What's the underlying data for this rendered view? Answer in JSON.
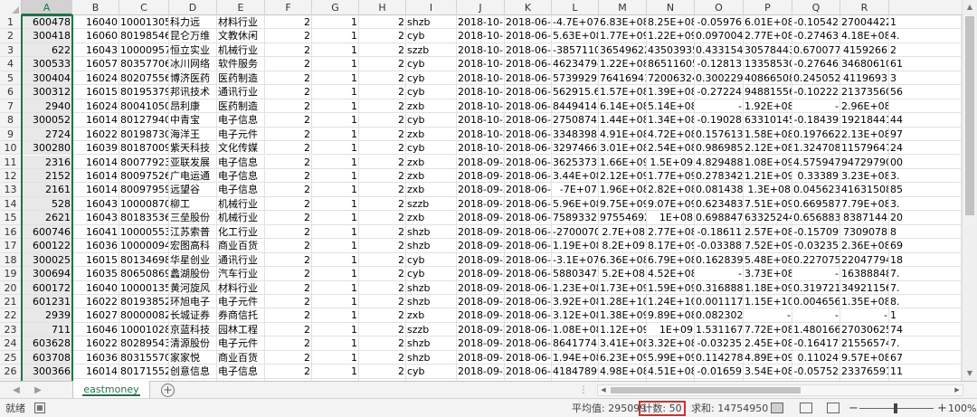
{
  "columns": [
    "A",
    "B",
    "C",
    "D",
    "E",
    "F",
    "G",
    "H",
    "I",
    "J",
    "K",
    "L",
    "M",
    "N",
    "O",
    "P",
    "Q",
    "R"
  ],
  "selected_column": "A",
  "rows": [
    [
      "600478",
      "16040",
      "10001305",
      "科力远",
      "材料行业",
      "2",
      "1",
      "2",
      "shzb",
      "2018-10-1",
      "2018-06-3",
      "-4.7E+07",
      "6.83E+08",
      "8.25E+08",
      "-0.05976",
      "6.01E+08",
      "-0.10542",
      "27004422"
    ],
    [
      "300418",
      "16060",
      "80198546",
      "昆仑万维",
      "文教休闲",
      "2",
      "1",
      "2",
      "cyb",
      "2018-10-1",
      "2018-06-3",
      "5.63E+08",
      "1.77E+09",
      "1.22E+09",
      "0.097004",
      "2.77E+08",
      "-0.27463",
      "4.18E+08"
    ],
    [
      "622",
      "16043",
      "10000957",
      "恒立实业",
      "机械行业",
      "2",
      "1",
      "2",
      "szzb",
      "2018-10-1",
      "2018-06-3",
      "-3857110",
      "36549622",
      "43503935",
      "0.433154",
      "30578443",
      "0.670077",
      "4159266"
    ],
    [
      "300533",
      "16057",
      "80357706",
      "冰川网络",
      "软件服务",
      "2",
      "1",
      "2",
      "cyb",
      "2018-10-1",
      "2018-06-3",
      "46234794",
      "1.22E+08",
      "86511605",
      "-0.12813",
      "13358530",
      "-0.27646",
      "34680610"
    ],
    [
      "300404",
      "16024",
      "80207556",
      "博济医药",
      "医药制造",
      "2",
      "1",
      "2",
      "cyb",
      "2018-10-1",
      "2018-06-3",
      "5739929",
      "76416941",
      "72006324",
      "0.300229",
      "40866508",
      "0.245052",
      "4119693"
    ],
    [
      "300312",
      "16015",
      "80195379",
      "邦讯技术",
      "通讯行业",
      "2",
      "1",
      "2",
      "cyb",
      "2018-10-1",
      "2018-06-3",
      "562915.6",
      "1.57E+08",
      "1.39E+08",
      "-0.27224",
      "94881556",
      "-0.10222",
      "21373560"
    ],
    [
      "2940",
      "16024",
      "80041050",
      "昂利康",
      "医药制造",
      "2",
      "1",
      "2",
      "zxb",
      "2018-10-1",
      "2018-06-3",
      "84494143",
      "6.14E+08",
      "5.14E+08",
      "-",
      "1.92E+08",
      "-",
      "2.96E+08"
    ],
    [
      "300052",
      "16014",
      "80127940",
      "中青宝",
      "电子信息",
      "2",
      "1",
      "2",
      "cyb",
      "2018-10-2",
      "2018-06-3",
      "27508742",
      "1.44E+08",
      "1.34E+08",
      "-0.19028",
      "63310145",
      "-0.18439",
      "19218441"
    ],
    [
      "2724",
      "16022",
      "80198730",
      "海洋王",
      "电子元件",
      "2",
      "1",
      "2",
      "zxb",
      "2018-10-2",
      "2018-06-3",
      "33483987",
      "4.91E+08",
      "4.72E+08",
      "0.157613",
      "1.58E+08",
      "0.197662",
      "2.13E+08"
    ],
    [
      "300280",
      "16039",
      "80187009",
      "紫天科技",
      "文化传媒",
      "2",
      "1",
      "2",
      "cyb",
      "2018-10-2",
      "2018-06-3",
      "32974669",
      "3.01E+08",
      "2.54E+08",
      "0.986985",
      "2.12E+08",
      "1.324708",
      "11579647"
    ],
    [
      "2316",
      "16014",
      "80077923",
      "亚联发展",
      "电子信息",
      "2",
      "1",
      "2",
      "zxb",
      "2018-09-2",
      "2018-06-3",
      "36253732",
      "1.66E+09",
      "1.5E+09",
      "4.829488",
      "1.08E+09",
      "4.575947",
      "94729790"
    ],
    [
      "2152",
      "16014",
      "80097526",
      "广电运通",
      "电子信息",
      "2",
      "1",
      "2",
      "zxb",
      "2018-09-2",
      "2018-06-3",
      "3.44E+08",
      "2.12E+09",
      "1.77E+09",
      "0.278342",
      "1.21E+09",
      "0.33389",
      "3.23E+08"
    ],
    [
      "2161",
      "16014",
      "80097959",
      "远望谷",
      "电子信息",
      "2",
      "1",
      "2",
      "zxb",
      "2018-09-2",
      "2018-06-3",
      "-7E+07",
      "1.96E+08",
      "2.82E+08",
      "0.081438",
      "1.3E+08",
      "0.045623",
      "41631508"
    ],
    [
      "528",
      "16043",
      "10000870",
      "柳工",
      "机械行业",
      "2",
      "1",
      "2",
      "szzb",
      "2018-09-2",
      "2018-06-3",
      "5.96E+08",
      "9.75E+09",
      "9.07E+09",
      "0.623483",
      "7.51E+09",
      "0.669587",
      "7.79E+08"
    ],
    [
      "2621",
      "16043",
      "80183536",
      "三垒股份",
      "机械行业",
      "2",
      "1",
      "2",
      "zxb",
      "2018-09-2",
      "2018-06-3",
      "7589332",
      "97554692",
      "1E+08",
      "0.698847",
      "63325244",
      "0.656883",
      "8387144"
    ],
    [
      "600746",
      "16041",
      "10000553",
      "江苏索普",
      "化工行业",
      "2",
      "1",
      "2",
      "shzb",
      "2018-09-2",
      "2018-06-3",
      "-2700070",
      "2.7E+08",
      "2.77E+08",
      "-0.18611",
      "2.57E+08",
      "-0.15709",
      "7309078"
    ],
    [
      "600122",
      "16036",
      "10000094",
      "宏图高科",
      "商业百货",
      "2",
      "1",
      "2",
      "shzb",
      "2018-09-2",
      "2018-06-3",
      "1.19E+08",
      "8.2E+09",
      "8.17E+09",
      "-0.03388",
      "7.52E+09",
      "-0.03235",
      "2.36E+08"
    ],
    [
      "300025",
      "16015",
      "80134698",
      "华星创业",
      "通讯行业",
      "2",
      "1",
      "2",
      "cyb",
      "2018-09-2",
      "2018-06-3",
      "-3.1E+07",
      "6.36E+08",
      "6.79E+08",
      "0.162839",
      "5.48E+08",
      "0.227075",
      "22047794"
    ],
    [
      "300694",
      "16035",
      "80650869",
      "蠡湖股份",
      "汽车行业",
      "2",
      "1",
      "2",
      "cyb",
      "2018-09-2",
      "2018-06-3",
      "58803472",
      "5.2E+08",
      "4.52E+08",
      "-",
      "3.73E+08",
      "-",
      "16388848"
    ],
    [
      "600172",
      "16040",
      "10000135",
      "黄河旋风",
      "材料行业",
      "2",
      "1",
      "2",
      "shzb",
      "2018-09-2",
      "2018-06-3",
      "1.23E+08",
      "1.73E+09",
      "1.59E+09",
      "0.316888",
      "1.18E+09",
      "0.319721",
      "34921156"
    ],
    [
      "601231",
      "16022",
      "80193852",
      "环旭电子",
      "电子元件",
      "2",
      "1",
      "2",
      "shzb",
      "2018-09-2",
      "2018-06-3",
      "3.92E+08",
      "1.28E+10",
      "1.24E+10",
      "0.001117",
      "1.15E+10",
      "0.004656",
      "1.35E+08"
    ],
    [
      "2939",
      "16027",
      "80000082",
      "长城证券",
      "券商信托",
      "2",
      "1",
      "2",
      "zxb",
      "2018-09-2",
      "2018-06-3",
      "3.12E+08",
      "1.38E+09",
      "9.89E+08",
      "0.082302",
      "-",
      "-",
      "-"
    ],
    [
      "711",
      "16046",
      "10001028",
      "京蓝科技",
      "园林工程",
      "2",
      "1",
      "2",
      "szzb",
      "2018-09-2",
      "2018-06-3",
      "1.08E+08",
      "1.12E+09",
      "1E+09",
      "1.531167",
      "7.72E+08",
      "1.480166",
      "27030625"
    ],
    [
      "603628",
      "16022",
      "80289543",
      "清源股份",
      "电子元件",
      "2",
      "1",
      "2",
      "shzb",
      "2018-09-2",
      "2018-06-3",
      "8641774",
      "3.41E+08",
      "3.32E+08",
      "-0.03235",
      "2.45E+08",
      "-0.16417",
      "21556574"
    ],
    [
      "603708",
      "16036",
      "80315570",
      "家家悦",
      "商业百货",
      "2",
      "1",
      "2",
      "shzb",
      "2018-09-2",
      "2018-06-3",
      "1.94E+08",
      "6.23E+09",
      "5.99E+09",
      "0.114278",
      "4.89E+09",
      "0.11024",
      "9.57E+08"
    ],
    [
      "300366",
      "16014",
      "80171552",
      "创意信息",
      "电子信息",
      "2",
      "1",
      "2",
      "cyb",
      "2018-09-2",
      "2018-06-3",
      "41847899",
      "4.98E+08",
      "4.51E+08",
      "-0.01659",
      "3.54E+08",
      "-0.05752",
      "23376591"
    ],
    [
      "677",
      "16026",
      "10000997",
      "恒天海龙",
      "化纤行业",
      "2",
      "1",
      "2",
      "szzb",
      "2018-09-2",
      "2018-06-3",
      "2031320",
      "3.34E+08",
      "3.26E+08",
      "0.23416",
      "2.95E+08",
      "0.26605",
      "10897946"
    ]
  ],
  "overflow": [
    "1",
    "4.",
    "2",
    "61",
    "3",
    "56",
    "",
    "44",
    "97",
    "24",
    "00",
    "3.",
    "85",
    "3.",
    "20",
    "8",
    "69",
    "18",
    "7.",
    "7.",
    "8.",
    "1",
    "74",
    "7.",
    "67",
    "11"
  ],
  "sheet_tabs": [
    {
      "label": "eastmoney",
      "active": true
    }
  ],
  "add_sheet_icon": "plus-circle-icon",
  "status": {
    "mode": "就绪",
    "average": "平均值: 295099",
    "count": "计数: 50",
    "sum": "求和: 14754950",
    "zoom": "100%",
    "zoom_minus": "−",
    "zoom_plus": "+"
  },
  "colors": {
    "accent": "#217346",
    "highlight_box": "#d32f2f"
  }
}
